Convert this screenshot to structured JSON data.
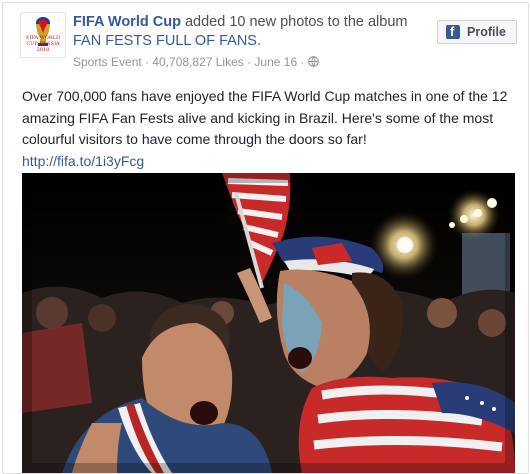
{
  "post": {
    "page_name": "FIFA World Cup",
    "action_text": " added 10 new photos to the album ",
    "album_name": "FAN FESTS FULL OF FANS",
    "album_suffix": ".",
    "meta_text": "Sports Event · 40,708,827 Likes · June 16 ·",
    "body_text": "Over 700,000 fans have enjoyed the FIFA World Cup matches in one of the 12 amazing FIFA Fan Fests alive and kicking in Brazil. Here's some of the most colourful visitors to have come through the doors so far!",
    "link_text": "http://fifa.to/1i3yFcg",
    "avatar_logo_text": "FIFA WORLD CUP RUSSIA 2018",
    "photo_description": "Two shouting fans draped in American flags at a night-time fan fest"
  },
  "profile_button": {
    "icon_letter": "f",
    "label": "Profile"
  },
  "icons": {
    "globe": "globe-icon",
    "facebook": "facebook-icon",
    "trophy": "world-cup-trophy-icon"
  },
  "colors": {
    "link_blue": "#365899",
    "meta_gray": "#90949c",
    "facebook_blue": "#3b5998",
    "logo_red": "#b8141f"
  }
}
